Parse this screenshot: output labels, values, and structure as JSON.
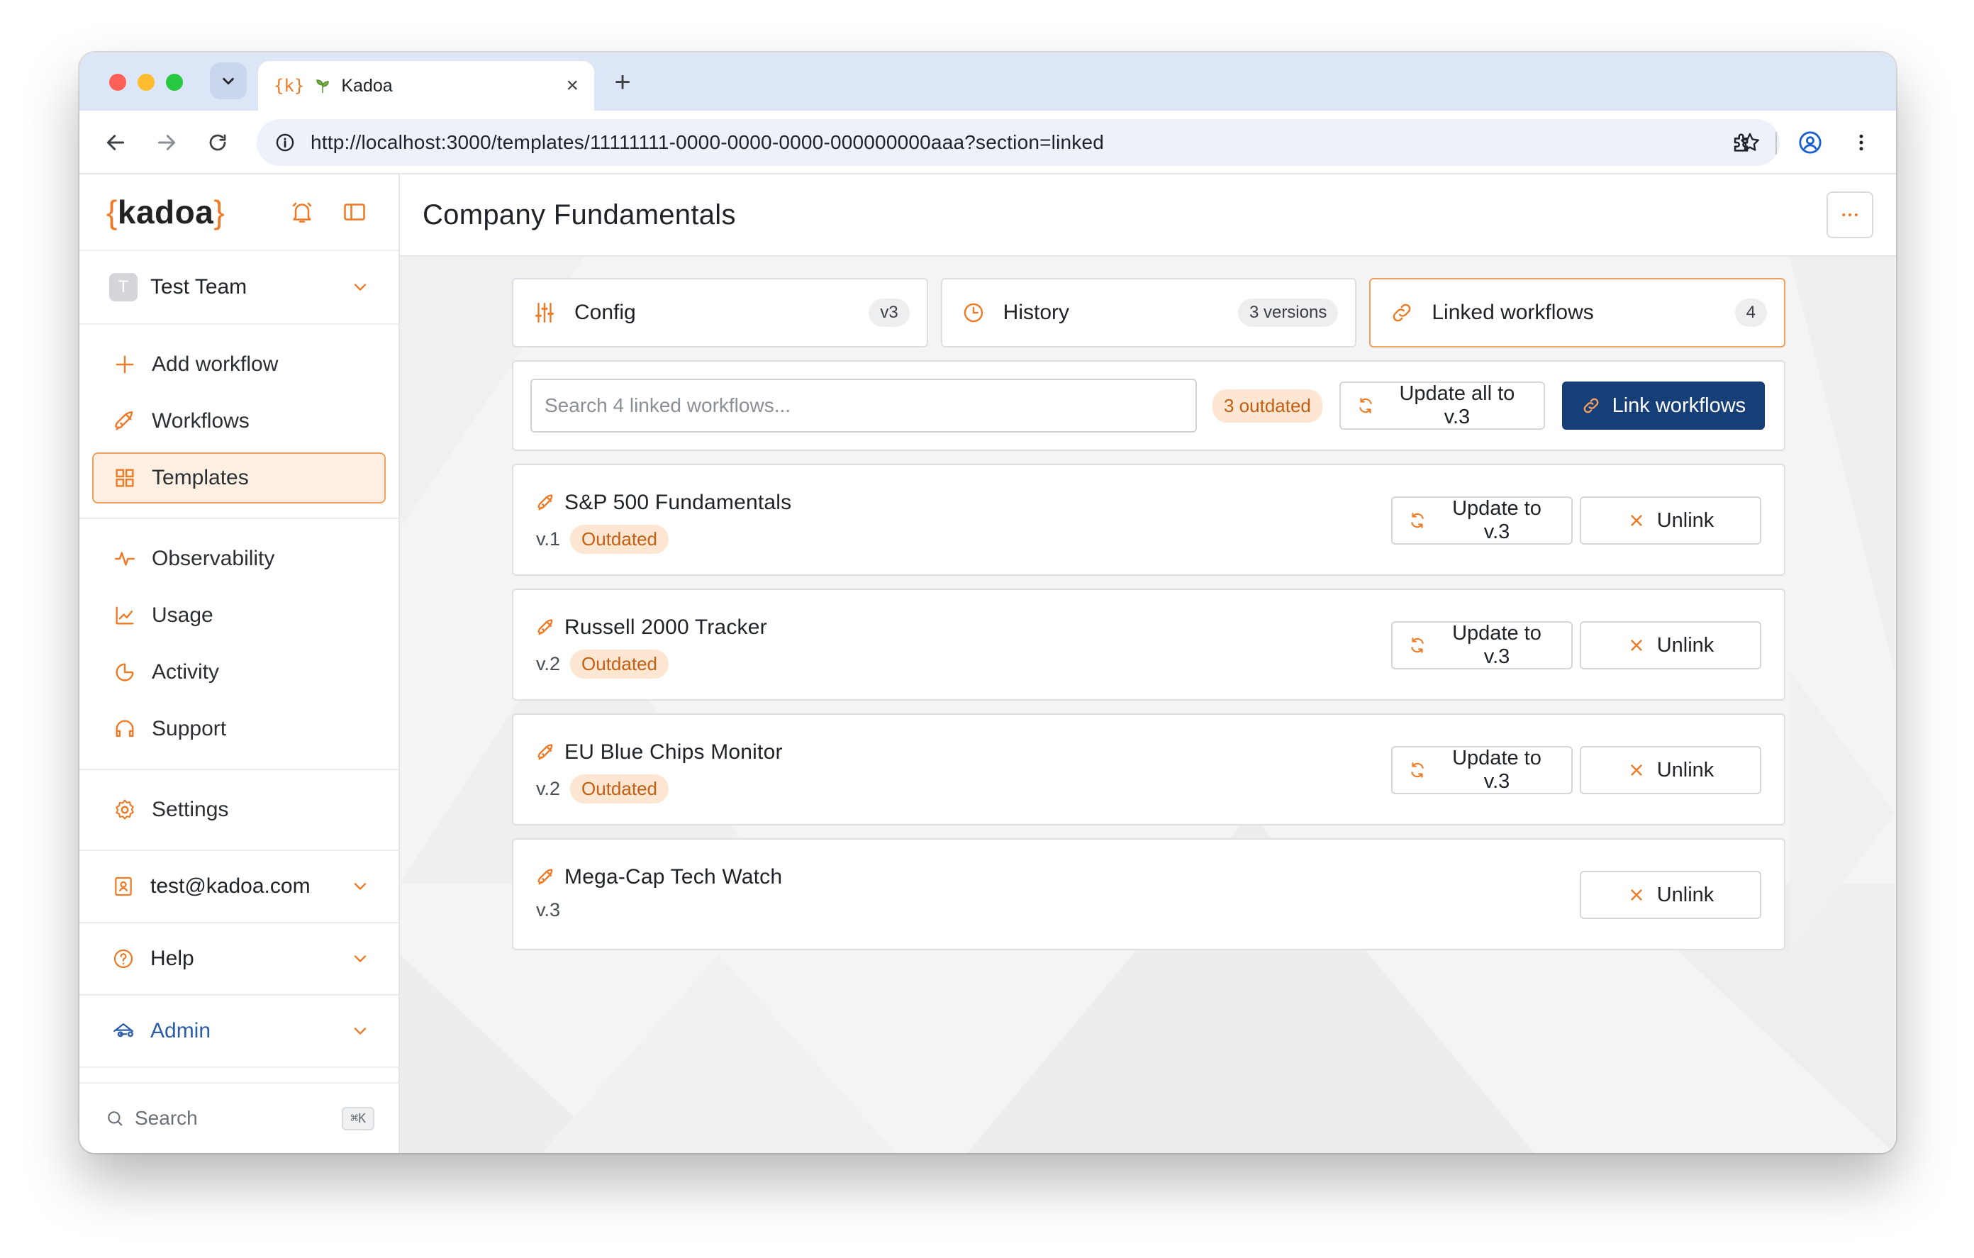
{
  "browser": {
    "tab_title": "Kadoa",
    "tab_favicon": "{k}",
    "url": "http://localhost:3000/templates/11111111-0000-0000-0000-000000000aaa?section=linked"
  },
  "sidebar": {
    "logo": {
      "open": "{",
      "text": "kadoa",
      "close": "}"
    },
    "team": {
      "avatar": "T",
      "name": "Test Team"
    },
    "primary_items": [
      {
        "label": "Add workflow",
        "icon": "plus-icon"
      },
      {
        "label": "Workflows",
        "icon": "rocket-icon"
      },
      {
        "label": "Templates",
        "icon": "grid-icon",
        "active": true
      }
    ],
    "secondary_items": [
      {
        "label": "Observability",
        "icon": "pulse-icon"
      },
      {
        "label": "Usage",
        "icon": "chart-icon"
      },
      {
        "label": "Activity",
        "icon": "activity-icon"
      },
      {
        "label": "Support",
        "icon": "headset-icon"
      }
    ],
    "settings": {
      "label": "Settings",
      "icon": "gear-icon"
    },
    "account": {
      "label": "test@kadoa.com"
    },
    "help": {
      "label": "Help"
    },
    "admin": {
      "label": "Admin"
    },
    "search": {
      "label": "Search",
      "shortcut": "⌘K"
    }
  },
  "main": {
    "title": "Company Fundamentals",
    "tabs": [
      {
        "label": "Config",
        "badge": "v3"
      },
      {
        "label": "History",
        "badge": "3 versions"
      },
      {
        "label": "Linked workflows",
        "badge": "4",
        "active": true
      }
    ],
    "toolbar": {
      "search_placeholder": "Search 4 linked workflows...",
      "outdated_badge": "3 outdated",
      "update_all_label": "Update all to v.3",
      "link_label": "Link workflows"
    },
    "workflows": [
      {
        "name": "S&P 500 Fundamentals",
        "version": "v.1",
        "status": "Outdated",
        "update_label": "Update to v.3",
        "unlink_label": "Unlink"
      },
      {
        "name": "Russell 2000 Tracker",
        "version": "v.2",
        "status": "Outdated",
        "update_label": "Update to v.3",
        "unlink_label": "Unlink"
      },
      {
        "name": "EU Blue Chips Monitor",
        "version": "v.2",
        "status": "Outdated",
        "update_label": "Update to v.3",
        "unlink_label": "Unlink"
      },
      {
        "name": "Mega-Cap Tech Watch",
        "version": "v.3",
        "status": "",
        "update_label": "",
        "unlink_label": "Unlink"
      }
    ]
  },
  "colors": {
    "accent": "#ee7a25",
    "primary_button": "#173f77",
    "badge_bg": "#fde7d3",
    "badge_text": "#c45e12",
    "admin": "#2a5ca8"
  }
}
